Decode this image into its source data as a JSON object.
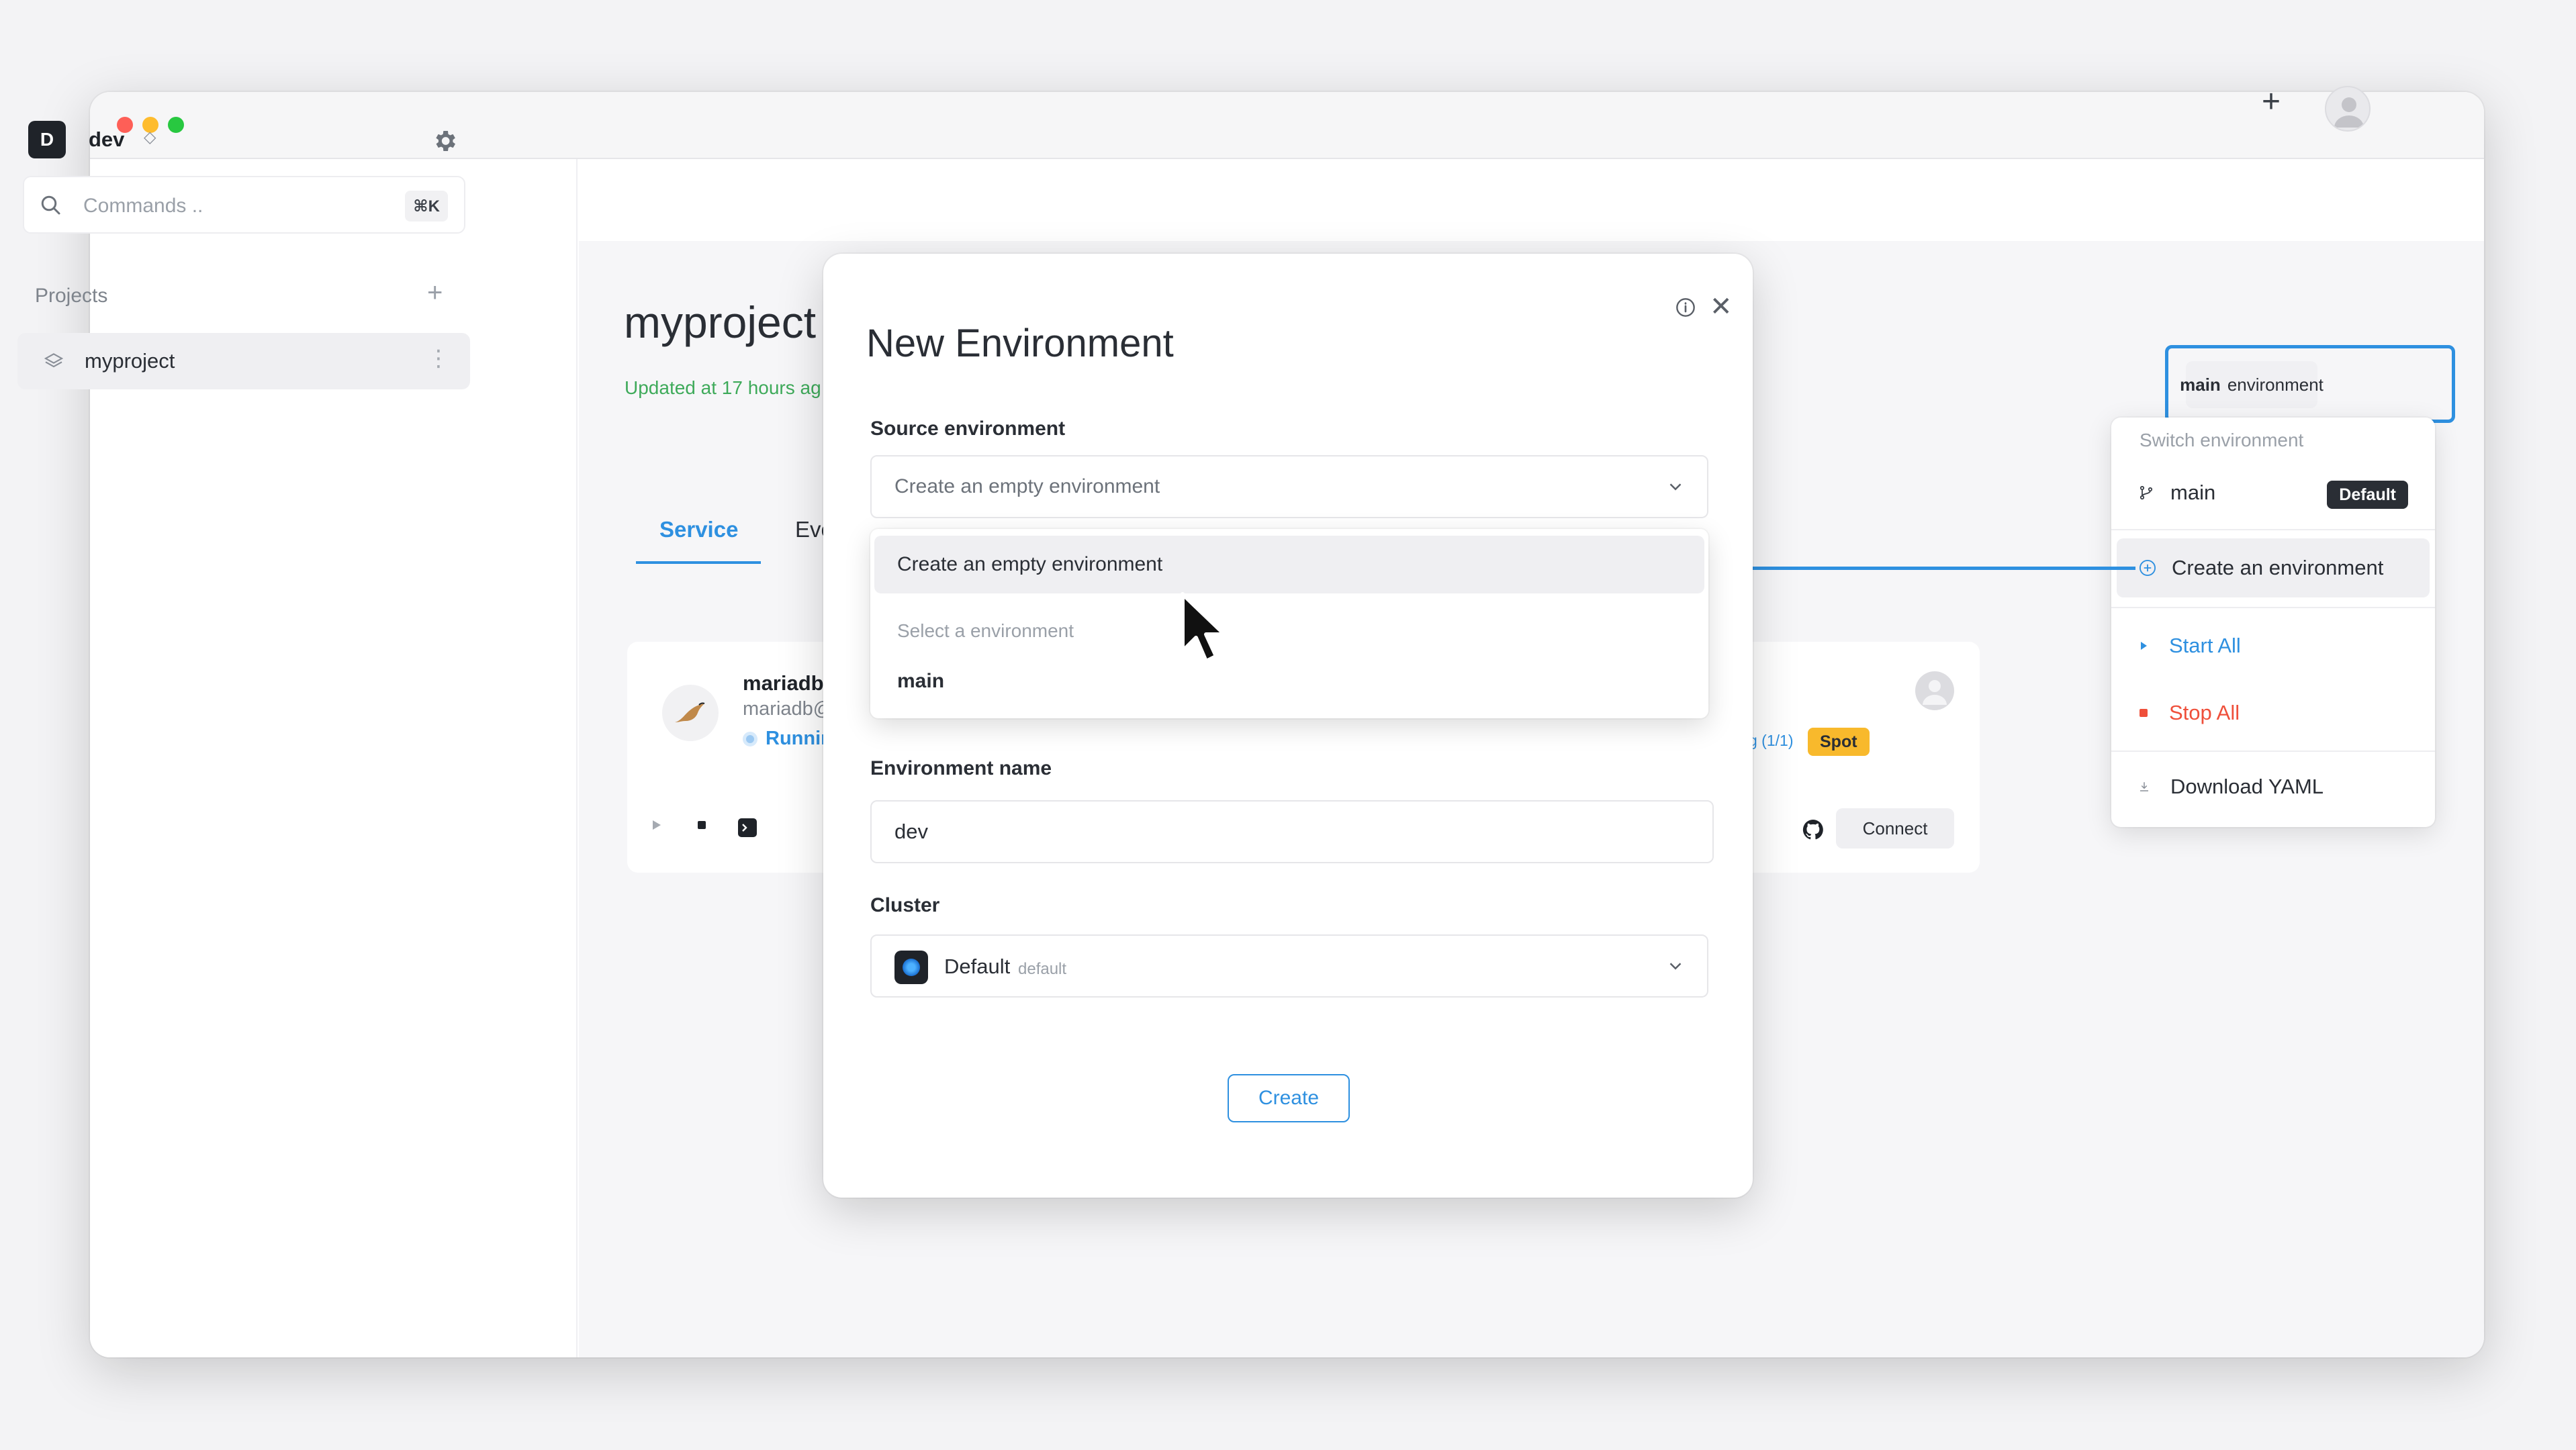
{
  "workspace": {
    "initial": "D",
    "name": "dev",
    "switch_glyph": "◇"
  },
  "sidebar": {
    "commands_placeholder": "Commands ..",
    "shortcut": "⌘K",
    "projects_label": "Projects",
    "projects_add": "+",
    "items": [
      {
        "label": "myproject",
        "more": "⋮"
      }
    ]
  },
  "header": {
    "add": "+"
  },
  "project": {
    "title": "myproject",
    "updated": "Updated at 17 hours ag",
    "tabs": [
      {
        "label": "Service"
      },
      {
        "label": "Eve"
      }
    ]
  },
  "service": {
    "name": "mariadb",
    "host": "mariadb@",
    "status": "Runnir",
    "replicas": "g (1/1)",
    "badge": "Spot",
    "connect_label": "Connect"
  },
  "env_switcher": {
    "button_label": "main",
    "button_suffix": "environment",
    "menu": {
      "label": "Switch environment",
      "env_main": "main",
      "default_badge": "Default",
      "create": "Create an environment",
      "start": "Start All",
      "stop": "Stop All",
      "yaml": "Download YAML"
    }
  },
  "modal": {
    "title": "New Environment",
    "source_label": "Source environment",
    "source_value": "Create an empty environment",
    "dropdown": {
      "option_empty": "Create an empty environment",
      "group_label": "Select a environment",
      "option_main": "main"
    },
    "name_label": "Environment name",
    "name_value": "dev",
    "cluster_label": "Cluster",
    "cluster_name": "Default",
    "cluster_sub": "default",
    "create_label": "Create"
  },
  "colors": {
    "accent": "#2e90e0",
    "danger": "#ef4f3a",
    "success": "#3eaa5a",
    "spot": "#f8b92c"
  }
}
